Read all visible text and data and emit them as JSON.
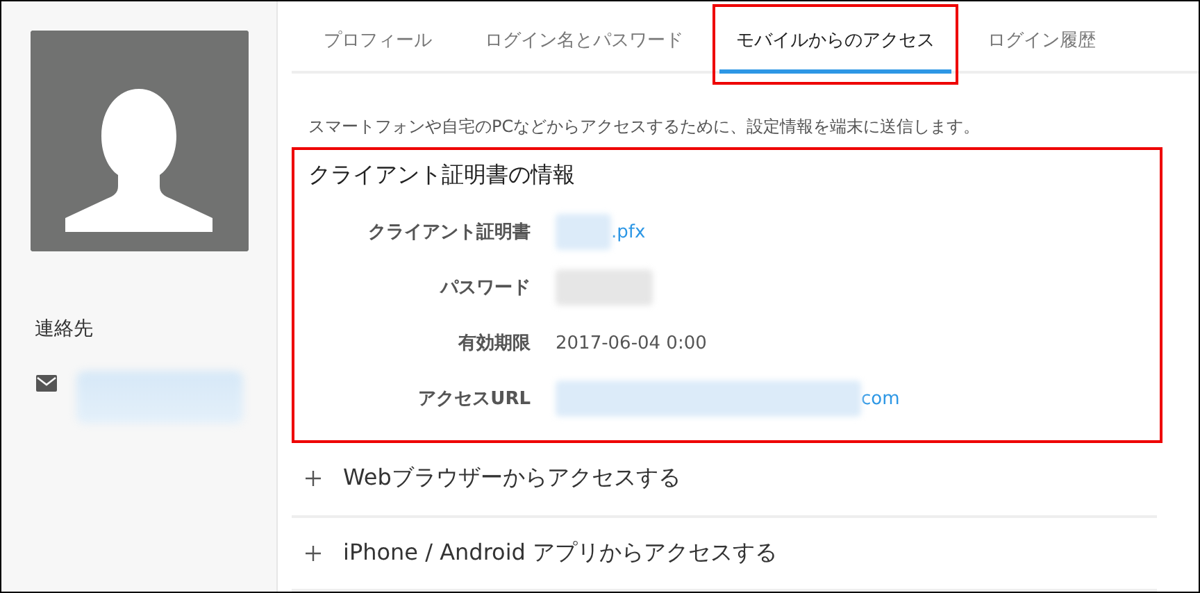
{
  "sidebar": {
    "contact_heading": "連絡先",
    "email_blurred": true
  },
  "tabs": [
    {
      "label": "プロフィール",
      "selected": false,
      "highlighted": false
    },
    {
      "label": "ログイン名とパスワード",
      "selected": false,
      "highlighted": false
    },
    {
      "label": "モバイルからのアクセス",
      "selected": true,
      "highlighted": true
    },
    {
      "label": "ログイン履歴",
      "selected": false,
      "highlighted": false
    }
  ],
  "description": "スマートフォンや自宅のPCなどからアクセスするために、設定情報を端末に送信します。",
  "certificate": {
    "title": "クライアント証明書の情報",
    "highlighted": true,
    "rows": [
      {
        "label": "クライアント証明書",
        "kind": "link",
        "value": ".pfx"
      },
      {
        "label": "パスワード",
        "kind": "masked"
      },
      {
        "label": "有効期限",
        "kind": "text",
        "value": "2017-06-04 0:00"
      },
      {
        "label": "アクセスURL",
        "kind": "link",
        "value": "com"
      }
    ]
  },
  "sections": [
    {
      "label": "Webブラウザーからアクセスする",
      "expanded": false
    },
    {
      "label": "iPhone / Android アプリからアクセスする",
      "expanded": false
    }
  ]
}
